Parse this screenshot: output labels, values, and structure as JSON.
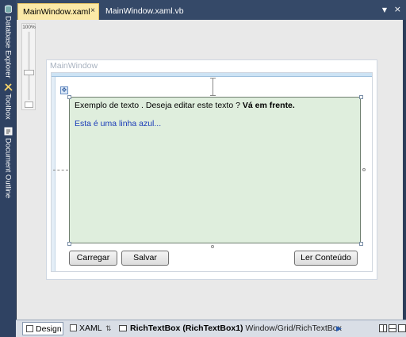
{
  "side_panel": {
    "tabs": [
      {
        "label": "Database Explorer",
        "icon": "database-icon"
      },
      {
        "label": "Toolbox",
        "icon": "toolbox-icon"
      },
      {
        "label": "Document Outline",
        "icon": "document-outline-icon"
      }
    ]
  },
  "tabs": {
    "active": "MainWindow.xaml",
    "inactive": "MainWindow.xaml.vb",
    "close_glyph": "×",
    "dropdown_glyph": "▼"
  },
  "zoom": {
    "percent": "100%"
  },
  "designer": {
    "window_title": "MainWindow",
    "richtextbox": {
      "line1_prefix": "Exemplo de texto . Deseja editar este texto ?",
      "line1_bold": "Vá em frente.",
      "line2": "Esta é uma linha azul..."
    },
    "buttons": {
      "carregar": "Carregar",
      "salvar": "Salvar",
      "ler": "Ler Conteúdo"
    }
  },
  "statusbar": {
    "design_label": "Design",
    "xaml_label": "XAML",
    "element": "RichTextBox (RichTextBox1)",
    "path": "Window/Grid/RichTextBox"
  },
  "colors": {
    "active_tab": "#fbe9a7",
    "richtextbox_bg": "#dfeedd",
    "blue_text": "#1a3cb8",
    "chrome": "#2c3d5a"
  }
}
